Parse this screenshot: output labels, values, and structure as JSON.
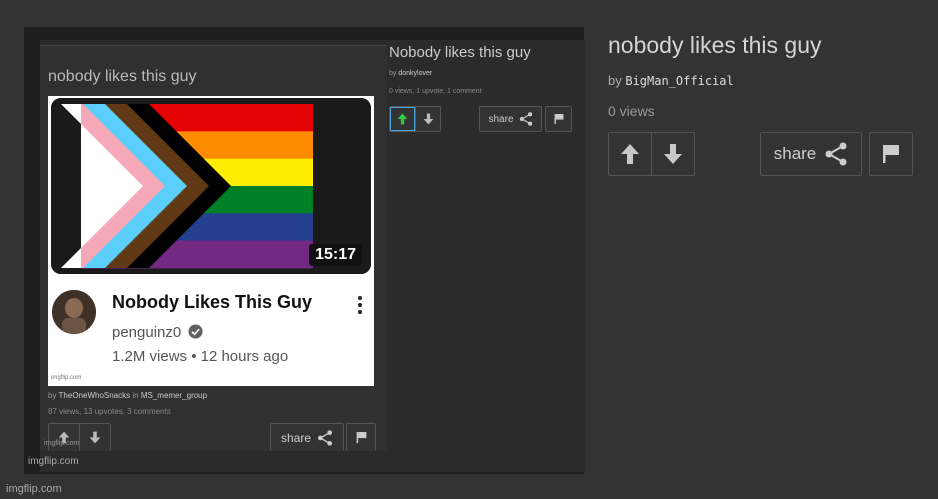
{
  "outer": {
    "title": "nobody likes this guy",
    "by_label": "by",
    "author": "BigMan_Official",
    "views": "0 views",
    "share_label": "share",
    "watermark": "imgflip.com"
  },
  "middle": {
    "title": "Nobody likes this guy",
    "by_label": "by",
    "author": "donkylover",
    "stats": "0 views, 1 upvote, 1 comment",
    "share_label": "share",
    "watermark": "imgflip.com"
  },
  "inner": {
    "title": "nobody likes this guy",
    "by_label": "by",
    "author": "TheOneWhoSnacks",
    "in_label": "in",
    "group": "MS_memer_group",
    "stats": "87 views, 13 upvotes, 3 comments",
    "share_label": "share",
    "watermark": "imgflip.com"
  },
  "video": {
    "duration": "15:17",
    "title": "Nobody Likes This Guy",
    "channel": "penguinz0",
    "meta": "1.2M views • 12 hours ago",
    "watermark": "imgflip.com"
  },
  "colors": {
    "upvote_active": "#2ecc40",
    "flag_stripes": [
      "#e40303",
      "#ff8c00",
      "#ffed00",
      "#008026",
      "#24408e",
      "#732982"
    ],
    "chevrons": [
      "#ffffff",
      "#f5a9b8",
      "#5bcefa",
      "#613915",
      "#000000"
    ]
  }
}
